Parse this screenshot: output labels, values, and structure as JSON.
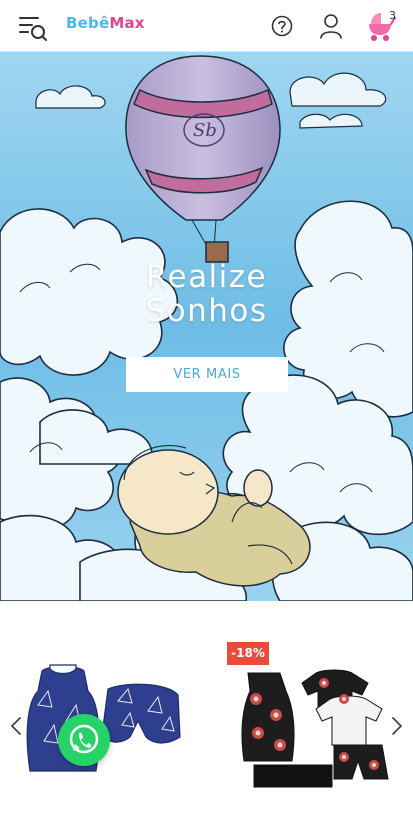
{
  "header": {
    "logo_part1": "Bebê",
    "logo_part2": "Max",
    "cart_count": "3",
    "icons": [
      "menu-search-icon",
      "help-icon",
      "user-icon",
      "baby-carriage-icon"
    ],
    "accent_blue": "#4fb7e6",
    "accent_pink": "#e6428f"
  },
  "hero": {
    "title_line1": "Realize",
    "title_line2": "Sonhos",
    "button_label": "VER MAIS",
    "sky_color": "#7cc4e8"
  },
  "products": {
    "items": [
      {
        "image_icon": "navy-sailboat-romper-set-icon",
        "discount_badge": ""
      },
      {
        "image_icon": "donut-print-romper-set-icon",
        "discount_badge": "-18%"
      }
    ],
    "prev_icon": "chevron-left-icon",
    "next_icon": "chevron-right-icon",
    "badge_color": "#e84c3d"
  },
  "chat": {
    "icon": "whatsapp-icon",
    "color": "#25d366"
  }
}
